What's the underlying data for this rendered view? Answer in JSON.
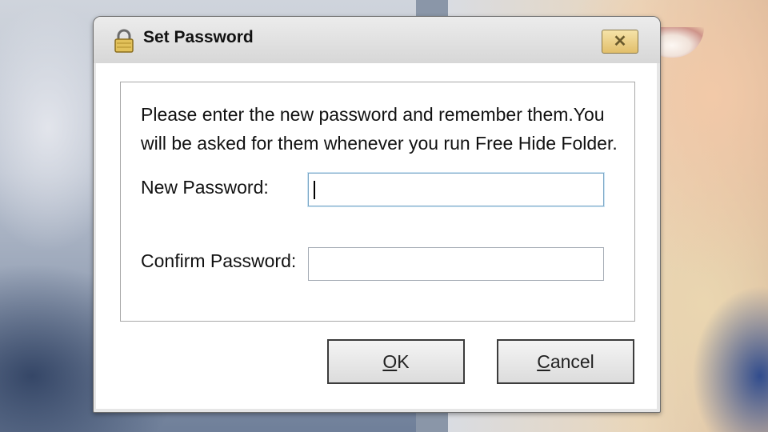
{
  "dialog": {
    "title": "Set Password",
    "title_icon": "lock-icon",
    "close_icon": "close-icon",
    "instructions": "Please enter the new password and remember them.You will be asked for them whenever you run Free Hide Folder.",
    "new_password_label": "New Password:",
    "new_password_value": "",
    "confirm_password_label": "Confirm Password:",
    "confirm_password_value": "",
    "ok_button": {
      "accel": "O",
      "rest": "K"
    },
    "cancel_button": {
      "accel": "C",
      "rest": "ancel"
    }
  },
  "colors": {
    "close_button": "#e2bf6b",
    "focus_border": "#7aa7c7"
  }
}
